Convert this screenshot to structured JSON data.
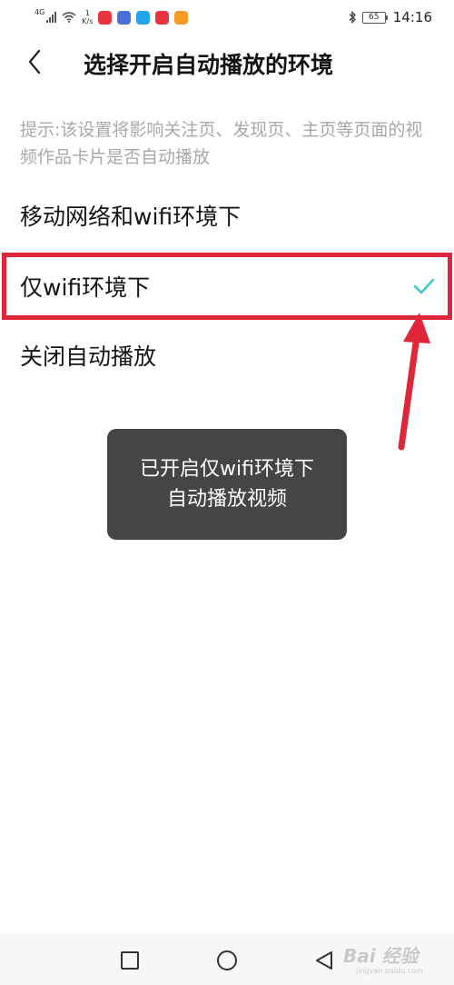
{
  "status_bar": {
    "network_type": "4G",
    "speed_value": "1",
    "speed_unit": "K/s",
    "battery": "65",
    "time": "14:16",
    "app_icon_colors": [
      "#e8343c",
      "#4a6fd8",
      "#23a4e8",
      "#e8343c",
      "#f59a23"
    ]
  },
  "header": {
    "title": "选择开启自动播放的环境",
    "back_icon": "chevron-left-icon"
  },
  "hint": "提示:该设置将影响关注页、发现页、主页等页面的视频作品卡片是否自动播放",
  "options": [
    {
      "label": "移动网络和wifi环境下",
      "selected": false
    },
    {
      "label": "仅wifi环境下",
      "selected": true
    },
    {
      "label": "关闭自动播放",
      "selected": false
    }
  ],
  "toast": "已开启仅wifi环境下自动播放视频",
  "watermark": {
    "text": "Bai 经验",
    "sub": "jingyan.baidu.com"
  },
  "colors": {
    "accent_check": "#3cc6c8",
    "highlight_box": "#e0263a",
    "toast_bg": "#454545",
    "hint_text": "#a8a8a8"
  }
}
